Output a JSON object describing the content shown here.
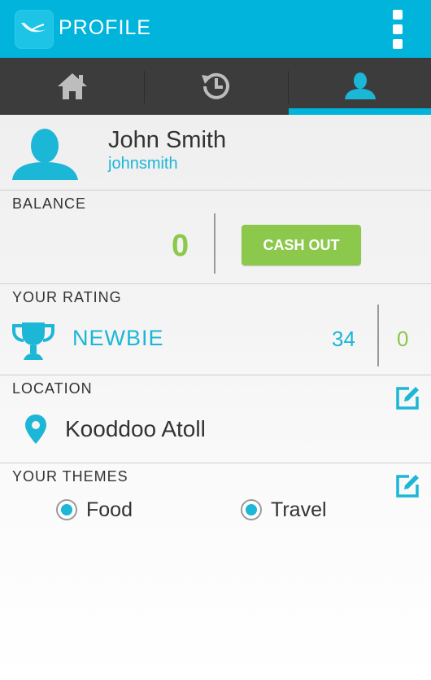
{
  "header": {
    "title": "PROFILE",
    "app_icon": "bird-logo-icon",
    "menu_icon": "overflow-menu-icon"
  },
  "tabs": [
    {
      "name": "home",
      "icon": "home-icon",
      "active": false
    },
    {
      "name": "history",
      "icon": "history-icon",
      "active": false
    },
    {
      "name": "profile",
      "icon": "user-icon",
      "active": true
    }
  ],
  "profile": {
    "name": "John Smith",
    "username": "johnsmith",
    "avatar_icon": "user-avatar-icon"
  },
  "balance": {
    "label": "BALANCE",
    "value": "0",
    "cash_out_label": "CASH OUT"
  },
  "rating": {
    "label": "YOUR RATING",
    "level": "NEWBIE",
    "score": "34",
    "secondary": "0",
    "icon": "trophy-icon"
  },
  "location": {
    "label": "LOCATION",
    "value": "Kooddoo Atoll",
    "icon": "map-pin-icon",
    "edit_icon": "edit-icon"
  },
  "themes": {
    "label": "YOUR THEMES",
    "edit_icon": "edit-icon",
    "items": [
      {
        "label": "Food",
        "selected": true
      },
      {
        "label": "Travel",
        "selected": true
      }
    ]
  },
  "colors": {
    "primary": "#00b4db",
    "accent_green": "#8cc84b",
    "tabbar": "#3c3c3c"
  }
}
